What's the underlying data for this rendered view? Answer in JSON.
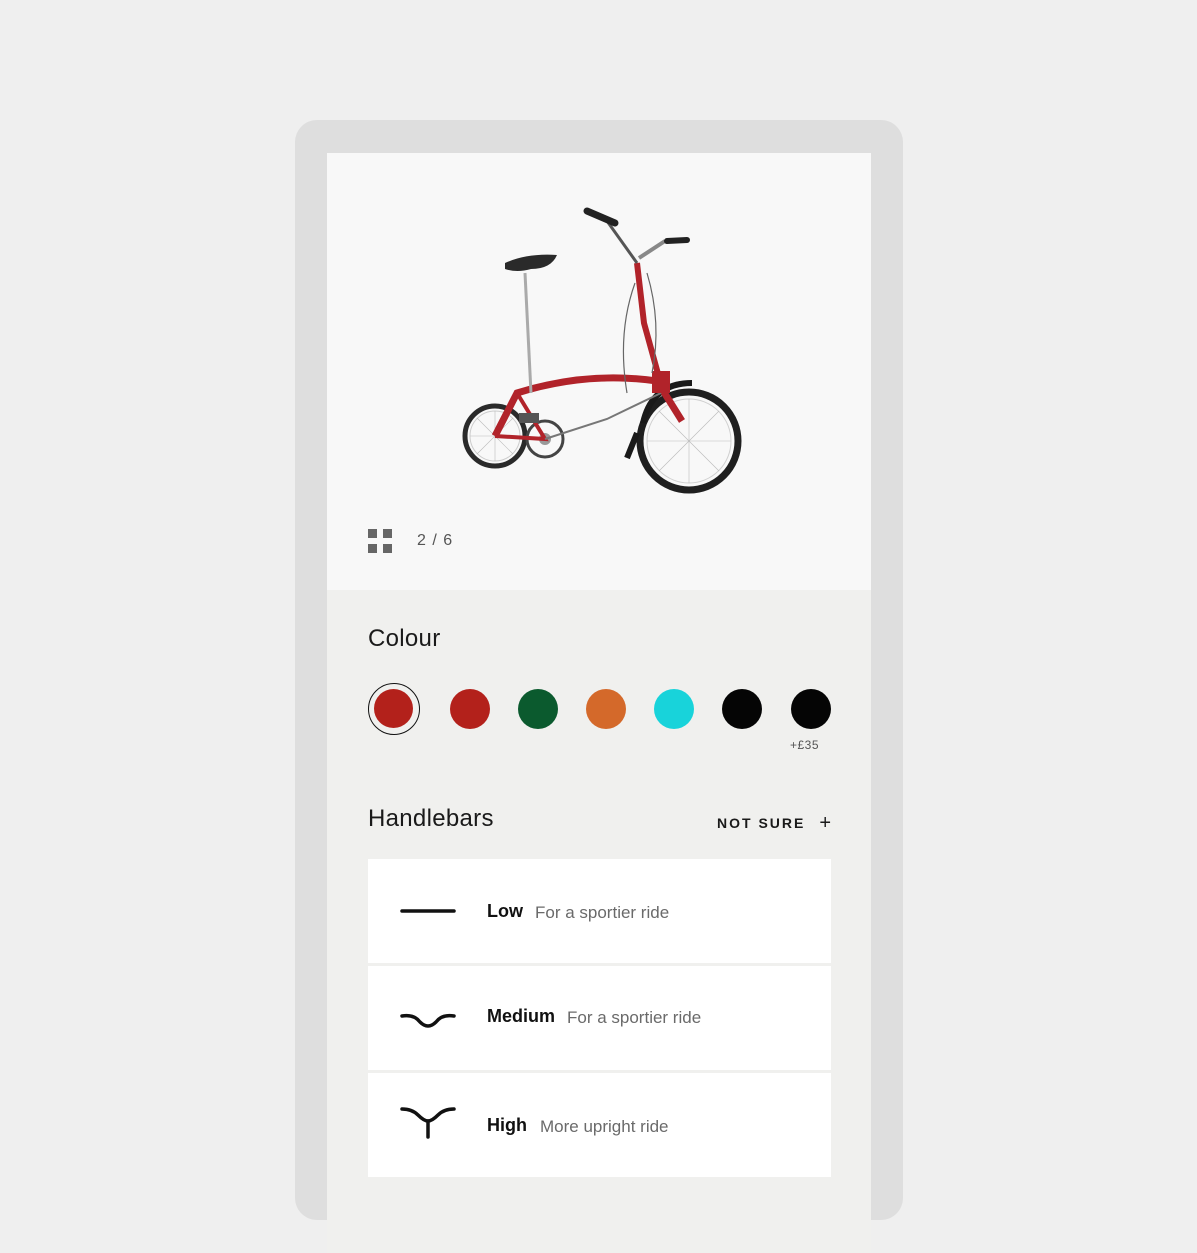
{
  "gallery": {
    "counter": "2 / 6",
    "icon": "grid-icon"
  },
  "colour": {
    "title": "Colour",
    "swatches": [
      {
        "color": "#b3211b",
        "selected": true
      },
      {
        "color": "#b3211b",
        "selected": false
      },
      {
        "color": "#0b5a2e",
        "selected": false
      },
      {
        "color": "#d4692a",
        "selected": false
      },
      {
        "color": "#18d3da",
        "selected": false
      },
      {
        "color": "#050505",
        "selected": false
      },
      {
        "color": "#050505",
        "selected": false,
        "price": "+£35"
      }
    ]
  },
  "handlebars": {
    "title": "Handlebars",
    "not_sure": "NOT SURE",
    "plus_icon": "plus-icon",
    "options": [
      {
        "name": "Low",
        "description": "For a sportier ride",
        "icon": "low-handlebar-icon"
      },
      {
        "name": "Medium",
        "description": "For a sportier ride",
        "icon": "medium-handlebar-icon"
      },
      {
        "name": "High",
        "description": "More upright ride",
        "icon": "high-handlebar-icon"
      }
    ]
  }
}
